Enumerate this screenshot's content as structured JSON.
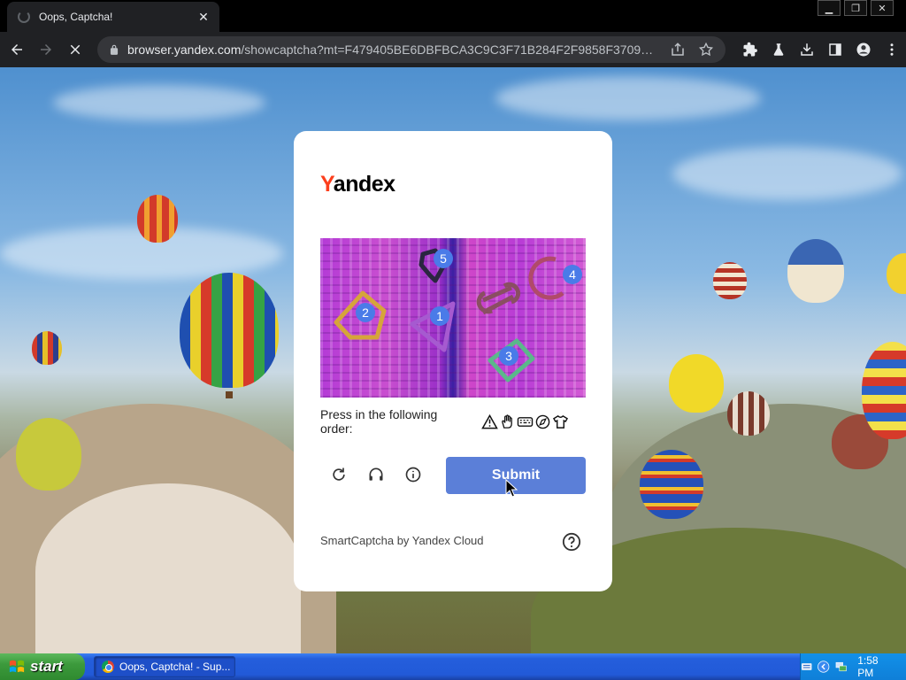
{
  "browser": {
    "tab_title": "Oops, Captcha!",
    "url_host": "browser.yandex.com",
    "url_path": "/showcaptcha?mt=F479405BE6DBFBCA3C9C3F71B284F2F9858F3709671..."
  },
  "captcha": {
    "logo_first": "Y",
    "logo_rest": "andex",
    "badges": [
      "1",
      "2",
      "3",
      "4",
      "5"
    ],
    "instruction": "Press in the following order:",
    "order_icons": [
      "warning-triangle-icon",
      "hand-icon",
      "keyboard-icon",
      "compass-icon",
      "t-shirt-icon"
    ],
    "submit_label": "Submit",
    "footer": "SmartCaptcha by Yandex Cloud"
  },
  "taskbar": {
    "start_label": "start",
    "task_label": "Oops, Captcha! - Sup...",
    "clock": "1:58 PM"
  },
  "colors": {
    "brand_red": "#fc3f1d",
    "submit_blue": "#5b7fd8",
    "badge_blue": "#4a7be8"
  }
}
